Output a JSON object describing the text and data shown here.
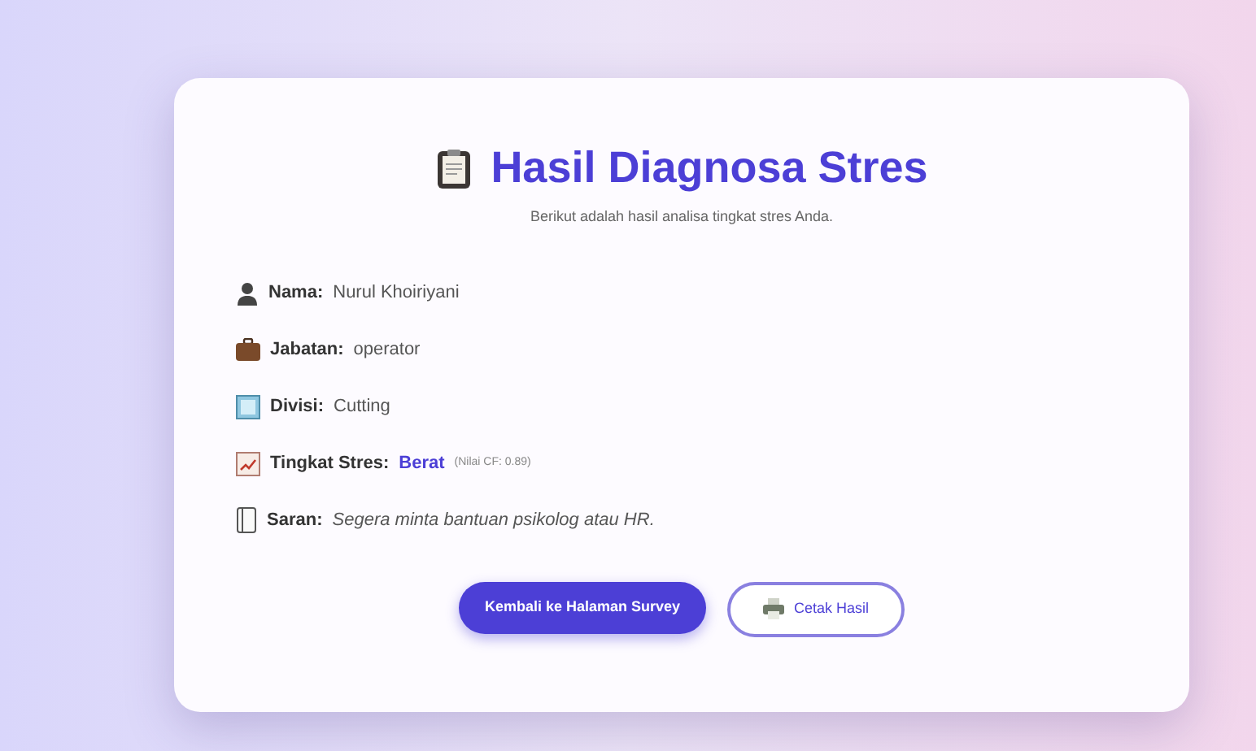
{
  "card": {
    "title": "Hasil Diagnosa Stres",
    "subtitle": "Berikut adalah hasil analisa tingkat stres Anda.",
    "items": [
      {
        "kind": "person",
        "label": "Nama:",
        "value": "Nurul Khoiriyani"
      },
      {
        "kind": "job",
        "label": "Jabatan:",
        "value": "operator"
      },
      {
        "kind": "division",
        "label": "Divisi:",
        "value": "Cutting"
      },
      {
        "kind": "level",
        "label": "Tingkat Stres:",
        "value": "Berat",
        "note": "(Nilai CF: 0.89)"
      },
      {
        "kind": "advice",
        "label": "Saran:",
        "value": "Segera minta bantuan psikolog atau HR."
      }
    ],
    "buttons": [
      {
        "kind": "primary",
        "label": "Kembali ke Halaman Survey"
      },
      {
        "kind": "print",
        "label": "Cetak Hasil"
      }
    ]
  }
}
